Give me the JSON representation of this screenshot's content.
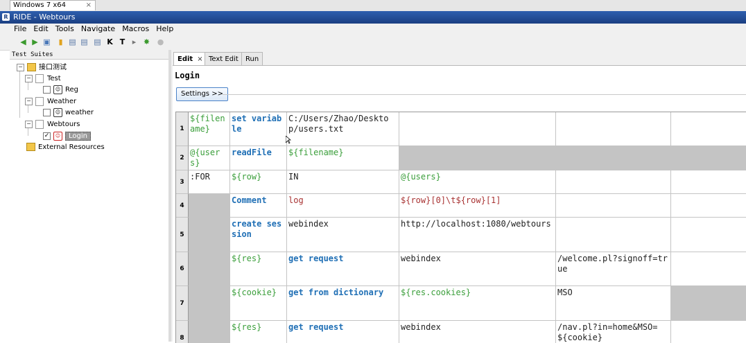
{
  "host_tab": {
    "label": "Windows 7 x64",
    "close": "×"
  },
  "window": {
    "title": "RIDE - Webtours"
  },
  "menu": [
    "File",
    "Edit",
    "Tools",
    "Navigate",
    "Macros",
    "Help"
  ],
  "tree": {
    "header": "Test Suites",
    "root": "接口测试",
    "suites": [
      {
        "name": "Test",
        "cases": [
          "Reg"
        ]
      },
      {
        "name": "Weather",
        "cases": [
          "weather"
        ]
      },
      {
        "name": "Webtours",
        "cases": [
          "Login"
        ]
      }
    ],
    "external": "External Resources"
  },
  "editor_tabs": [
    {
      "label": "Edit",
      "close": "×"
    },
    {
      "label": "Text Edit"
    },
    {
      "label": "Run"
    }
  ],
  "keyword_name": "Login",
  "settings_button": "Settings >>",
  "rows": [
    {
      "num": "1",
      "cells": [
        {
          "text": "${filename}",
          "style": "var"
        },
        {
          "text": "set variable",
          "style": "kw"
        },
        {
          "text": "C:/Users/Zhao/Desktop/users.txt",
          "style": "plain"
        },
        {
          "text": "",
          "style": "plain"
        },
        {
          "text": "",
          "style": "plain"
        },
        {
          "text": "",
          "style": "plain"
        }
      ]
    },
    {
      "num": "2",
      "cells": [
        {
          "text": "@{users}",
          "style": "var"
        },
        {
          "text": "readFile",
          "style": "kw"
        },
        {
          "text": "${filename}",
          "style": "var"
        },
        {
          "text": "",
          "style": "shade"
        },
        {
          "text": "",
          "style": "shade"
        },
        {
          "text": "",
          "style": "shade"
        }
      ]
    },
    {
      "num": "3",
      "cells": [
        {
          "text": ":FOR",
          "style": "plain"
        },
        {
          "text": "${row}",
          "style": "var"
        },
        {
          "text": "IN",
          "style": "plain"
        },
        {
          "text": "@{users}",
          "style": "var"
        },
        {
          "text": "",
          "style": "plain"
        },
        {
          "text": "",
          "style": "plain"
        }
      ]
    },
    {
      "num": "4",
      "cells": [
        {
          "text": "",
          "style": "shade"
        },
        {
          "text": "Comment",
          "style": "kw"
        },
        {
          "text": "log",
          "style": "str"
        },
        {
          "text": "${row}[0]\\t${row}[1]",
          "style": "str"
        },
        {
          "text": "",
          "style": "plain"
        },
        {
          "text": "",
          "style": "plain"
        }
      ]
    },
    {
      "num": "5",
      "cells": [
        {
          "text": "",
          "style": "shade"
        },
        {
          "text": "create session",
          "style": "kw"
        },
        {
          "text": "webindex",
          "style": "plain"
        },
        {
          "text": "http://localhost:1080/webtours",
          "style": "plain"
        },
        {
          "text": "",
          "style": "plain"
        },
        {
          "text": "",
          "style": "plain"
        }
      ]
    },
    {
      "num": "6",
      "cells": [
        {
          "text": "",
          "style": "shade"
        },
        {
          "text": "${res}",
          "style": "var"
        },
        {
          "text": "get request",
          "style": "kw"
        },
        {
          "text": "webindex",
          "style": "plain"
        },
        {
          "text": "/welcome.pl?signoff=true",
          "style": "plain"
        },
        {
          "text": "",
          "style": "plain"
        }
      ]
    },
    {
      "num": "7",
      "cells": [
        {
          "text": "",
          "style": "shade"
        },
        {
          "text": "${cookie}",
          "style": "var"
        },
        {
          "text": "get from dictionary",
          "style": "kw"
        },
        {
          "text": "${res.cookies}",
          "style": "var"
        },
        {
          "text": "MSO",
          "style": "plain"
        },
        {
          "text": "",
          "style": "shade"
        }
      ]
    },
    {
      "num": "8",
      "cells": [
        {
          "text": "",
          "style": "shade"
        },
        {
          "text": "${res}",
          "style": "var"
        },
        {
          "text": "get request",
          "style": "kw"
        },
        {
          "text": "webindex",
          "style": "plain"
        },
        {
          "text": "/nav.pl?in=home&MSO=${cookie}",
          "style": "plain"
        },
        {
          "text": "",
          "style": "plain"
        }
      ]
    }
  ],
  "colors": {
    "variable": "#3a9e3a",
    "keyword": "#1f6fb5",
    "string": "#a83232",
    "shade": "#c4c4c4"
  }
}
